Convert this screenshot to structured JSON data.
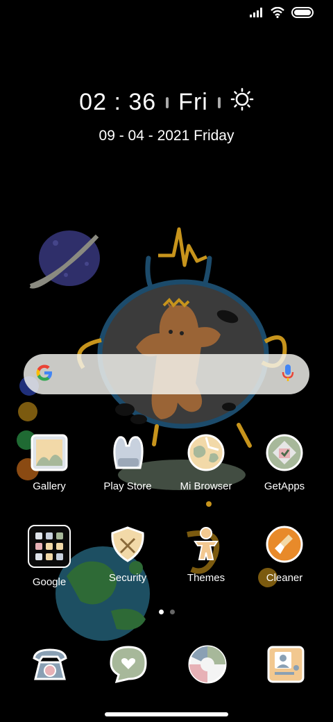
{
  "status_bar": {
    "icons": [
      "signal-icon",
      "wifi-icon",
      "battery-icon"
    ]
  },
  "clock": {
    "hours": "02",
    "separator": ":",
    "minutes": "36",
    "day_short": "Fri",
    "weather_icon": "sun-icon",
    "date": "09 - 04 - 2021 Friday"
  },
  "search": {
    "logo": "google-logo-icon",
    "mic_icon": "mic-icon"
  },
  "apps_row1": [
    {
      "label": "Gallery",
      "icon": "gallery-icon"
    },
    {
      "label": "Play Store",
      "icon": "play-store-icon"
    },
    {
      "label": "Mi Browser",
      "icon": "browser-icon"
    },
    {
      "label": "GetApps",
      "icon": "getapps-icon"
    }
  ],
  "apps_row2": [
    {
      "label": "Google",
      "icon": "google-folder-icon"
    },
    {
      "label": "Security",
      "icon": "security-icon"
    },
    {
      "label": "Themes",
      "icon": "themes-icon"
    },
    {
      "label": "Cleaner",
      "icon": "cleaner-icon"
    }
  ],
  "page_indicator": {
    "pages": 2,
    "active": 0
  },
  "dock": [
    {
      "icon": "phone-icon"
    },
    {
      "icon": "messages-icon"
    },
    {
      "icon": "camera-icon"
    },
    {
      "icon": "contacts-icon"
    }
  ],
  "colors": {
    "background": "#000000",
    "accent_orange": "#e88a2a",
    "pastel_green": "#a7b89a",
    "pastel_cream": "#f2d9a8",
    "pastel_pink": "#e7b1b6"
  }
}
